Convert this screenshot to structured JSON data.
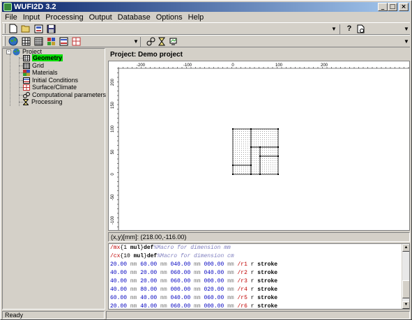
{
  "window": {
    "title": "WUFI2D 3.2"
  },
  "menu": [
    "File",
    "Input",
    "Processing",
    "Output",
    "Database",
    "Options",
    "Help"
  ],
  "tree": {
    "root": "Project",
    "items": [
      {
        "label": "Geometry",
        "icon": "geometry-icon",
        "selected": true
      },
      {
        "label": "Grid",
        "icon": "grid-icon"
      },
      {
        "label": "Materials",
        "icon": "materials-icon"
      },
      {
        "label": "Initial Conditions",
        "icon": "initial-conditions-icon"
      },
      {
        "label": "Surface/Climate",
        "icon": "surface-climate-icon"
      },
      {
        "label": "Computational parameters",
        "icon": "computational-parameters-icon"
      },
      {
        "label": "Processing",
        "icon": "hourglass-icon"
      }
    ]
  },
  "project": {
    "header": "Project: Demo project"
  },
  "rulers": {
    "x_ticks": [
      "-200",
      "-100",
      "0",
      "100",
      "200"
    ],
    "y_ticks": [
      "200",
      "150",
      "100",
      "50",
      "0",
      "-50",
      "-100"
    ]
  },
  "coord_readout": "(x,y)[mm]: (218.00,-116.00)",
  "code": [
    [
      {
        "t": "/mx",
        "c": "name"
      },
      {
        "t": "{1 ",
        "c": "op"
      },
      {
        "t": "mul",
        "c": "kw"
      },
      {
        "t": "}",
        "c": "op"
      },
      {
        "t": "def",
        "c": "kw"
      },
      {
        "t": "%Macro for dimension mm",
        "c": "cmt"
      }
    ],
    [
      {
        "t": "/cx",
        "c": "name"
      },
      {
        "t": "{10 ",
        "c": "op"
      },
      {
        "t": "mul",
        "c": "kw"
      },
      {
        "t": "}",
        "c": "op"
      },
      {
        "t": "def",
        "c": "kw"
      },
      {
        "t": "%Macro for dimension cm",
        "c": "cmt"
      }
    ],
    [
      {
        "t": "20.00",
        "c": "num"
      },
      {
        "t": " mm ",
        "c": "unit"
      },
      {
        "t": "60.00",
        "c": "num"
      },
      {
        "t": " mm ",
        "c": "unit"
      },
      {
        "t": "040.00",
        "c": "num"
      },
      {
        "t": " mm ",
        "c": "unit"
      },
      {
        "t": "000.00",
        "c": "num"
      },
      {
        "t": " mm ",
        "c": "unit"
      },
      {
        "t": "/r1",
        "c": "name"
      },
      {
        "t": " r ",
        "c": "op"
      },
      {
        "t": "stroke",
        "c": "kw"
      }
    ],
    [
      {
        "t": "40.00",
        "c": "num"
      },
      {
        "t": " mm ",
        "c": "unit"
      },
      {
        "t": "20.00",
        "c": "num"
      },
      {
        "t": " mm ",
        "c": "unit"
      },
      {
        "t": "060.00",
        "c": "num"
      },
      {
        "t": " mm ",
        "c": "unit"
      },
      {
        "t": "040.00",
        "c": "num"
      },
      {
        "t": " mm ",
        "c": "unit"
      },
      {
        "t": "/r2",
        "c": "name"
      },
      {
        "t": " r ",
        "c": "op"
      },
      {
        "t": "stroke",
        "c": "kw"
      }
    ],
    [
      {
        "t": "40.00",
        "c": "num"
      },
      {
        "t": " mm ",
        "c": "unit"
      },
      {
        "t": "20.00",
        "c": "num"
      },
      {
        "t": " mm ",
        "c": "unit"
      },
      {
        "t": "060.00",
        "c": "num"
      },
      {
        "t": " mm ",
        "c": "unit"
      },
      {
        "t": "000.00",
        "c": "num"
      },
      {
        "t": " mm ",
        "c": "unit"
      },
      {
        "t": "/r3",
        "c": "name"
      },
      {
        "t": " r ",
        "c": "op"
      },
      {
        "t": "stroke",
        "c": "kw"
      }
    ],
    [
      {
        "t": "40.00",
        "c": "num"
      },
      {
        "t": " mm ",
        "c": "unit"
      },
      {
        "t": "80.00",
        "c": "num"
      },
      {
        "t": " mm ",
        "c": "unit"
      },
      {
        "t": "000.00",
        "c": "num"
      },
      {
        "t": " mm ",
        "c": "unit"
      },
      {
        "t": "020.00",
        "c": "num"
      },
      {
        "t": " mm ",
        "c": "unit"
      },
      {
        "t": "/r4",
        "c": "name"
      },
      {
        "t": " r ",
        "c": "op"
      },
      {
        "t": "stroke",
        "c": "kw"
      }
    ],
    [
      {
        "t": "60.00",
        "c": "num"
      },
      {
        "t": " mm ",
        "c": "unit"
      },
      {
        "t": "40.00",
        "c": "num"
      },
      {
        "t": " mm ",
        "c": "unit"
      },
      {
        "t": "040.00",
        "c": "num"
      },
      {
        "t": " mm ",
        "c": "unit"
      },
      {
        "t": "060.00",
        "c": "num"
      },
      {
        "t": " mm ",
        "c": "unit"
      },
      {
        "t": "/r5",
        "c": "name"
      },
      {
        "t": " r ",
        "c": "op"
      },
      {
        "t": "stroke",
        "c": "kw"
      }
    ],
    [
      {
        "t": "20.00",
        "c": "num"
      },
      {
        "t": " mm ",
        "c": "unit"
      },
      {
        "t": "40.00",
        "c": "num"
      },
      {
        "t": " mm ",
        "c": "unit"
      },
      {
        "t": "060.00",
        "c": "num"
      },
      {
        "t": " mm ",
        "c": "unit"
      },
      {
        "t": "000.00",
        "c": "num"
      },
      {
        "t": " mm ",
        "c": "unit"
      },
      {
        "t": "/r6",
        "c": "name"
      },
      {
        "t": " r ",
        "c": "op"
      },
      {
        "t": "stroke",
        "c": "kw"
      }
    ]
  ],
  "status": {
    "text": "Ready"
  },
  "colors": {
    "selected_tree_item": "#00e000",
    "title_start": "#0a246a",
    "title_end": "#a6caf0"
  }
}
